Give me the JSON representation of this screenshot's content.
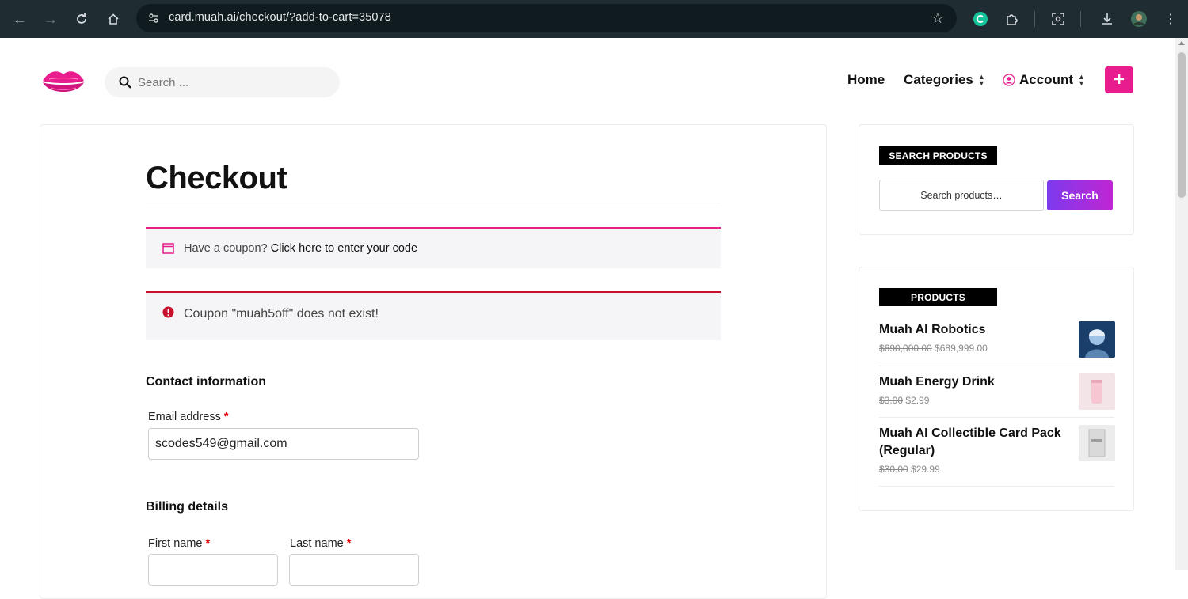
{
  "browser": {
    "url": "card.muah.ai/checkout/?add-to-cart=35078"
  },
  "header": {
    "search_placeholder": "Search ...",
    "nav": {
      "home": "Home",
      "categories": "Categories",
      "account": "Account"
    },
    "plus_label": "+"
  },
  "checkout": {
    "title": "Checkout",
    "coupon_prompt": "Have a coupon?",
    "coupon_link": "Click here to enter your code",
    "error_message": "Coupon \"muah5off\" does not exist!",
    "contact_heading": "Contact information",
    "email_label": "Email address",
    "email_value": "scodes549@gmail.com",
    "billing_heading": "Billing details",
    "first_name_label": "First name",
    "last_name_label": "Last name",
    "required_mark": "*"
  },
  "sidebar": {
    "search_widget": {
      "heading": "SEARCH PRODUCTS",
      "placeholder": "Search products…",
      "button": "Search"
    },
    "products_widget": {
      "heading": "PRODUCTS",
      "items": [
        {
          "name": "Muah AI Robotics",
          "old_price": "$690,000.00",
          "price": "$689,999.00"
        },
        {
          "name": "Muah Energy Drink",
          "old_price": "$3.00",
          "price": "$2.99"
        },
        {
          "name": "Muah AI Collectible Card Pack (Regular)",
          "old_price": "$30.00",
          "price": "$29.99"
        }
      ]
    }
  },
  "colors": {
    "brand_pink": "#e81c8c",
    "error_red": "#c8102e",
    "search_gradient_start": "#7c3aed",
    "search_gradient_end": "#c026d3"
  }
}
